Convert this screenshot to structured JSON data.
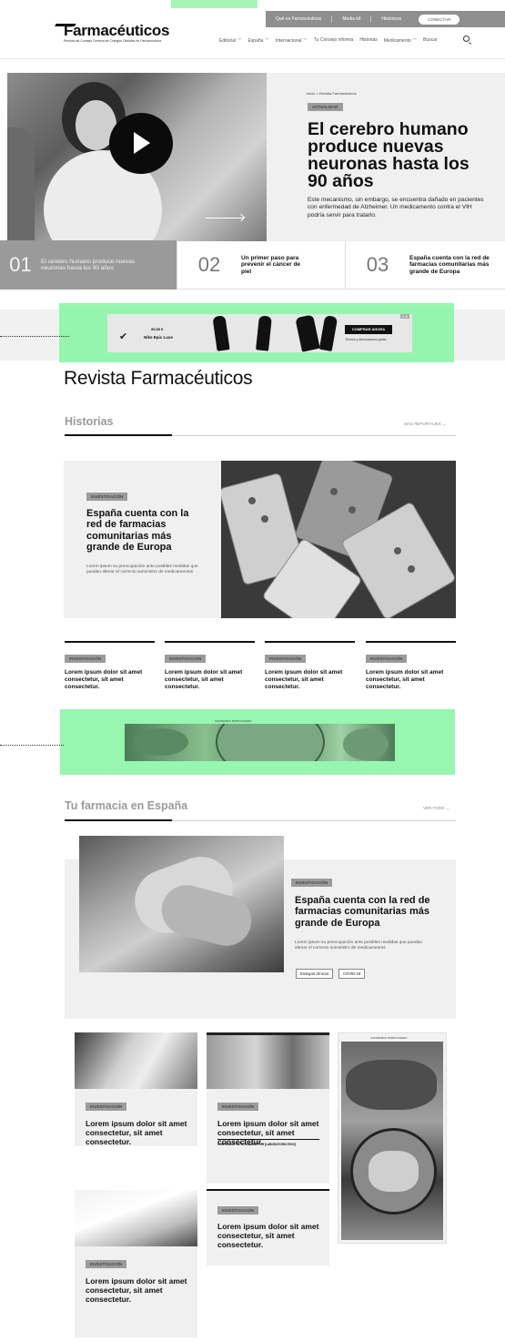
{
  "topbar": {
    "links": [
      "Qué es Farmacéuticos",
      "Media kit",
      "Históricos"
    ],
    "connect": "CONECTAR"
  },
  "brand": {
    "name": "Farmacéuticos",
    "subtitle": "Revista del Consejo General de Colegios Oficiales de Farmacéuticos"
  },
  "nav": {
    "items": [
      "Editorial ﹀",
      "España ﹀",
      "Internacional ﹀",
      "Tu Consejo informa",
      "Historias",
      "Medicamento ﹀",
      "Buscar"
    ]
  },
  "hero": {
    "breadcrumb": "Inicio > Revista Farmacéuticos",
    "tag": "ACTUALIDAD",
    "title": "El cerebro humano produce nuevas neuronas hasta los 90 años",
    "lead": "Este mecanismo, sin embargo, se encuentra dañado en pacientes con enfermedad de Alzheimer. Un medicamento contra el VIH podría servir para tratarlo."
  },
  "strip": [
    {
      "num": "01",
      "text": "El cerebro humano produce nuevas neuronas hasta los 90 años"
    },
    {
      "num": "02",
      "text": "Un primer paso para prevenir el cáncer de piel"
    },
    {
      "num": "03",
      "text": "España cuenta con la red de farmacias comunitarias más grande de Europa"
    }
  ],
  "ad1": {
    "price": "99,99 €",
    "product": "Nike Epic Luxe",
    "cta": "COMPRAR AHORA",
    "sub": "Envíos y devoluciones gratis",
    "badge": "▷✕"
  },
  "revista": {
    "title": "Revista Farmacéuticos"
  },
  "historias": {
    "heading": "Historias",
    "more": "MÁS REPORTAJES →",
    "featured": {
      "tag": "INVESTIGACIÓN",
      "title": "España cuenta con la red de farmacias comunitarias más grande de Europa",
      "desc": "Lorem ipsum su preocupación ante posibles medidas que puedan alterar el correcto suministro de medicamentos"
    },
    "cards": [
      {
        "tag": "INVESTIGACIÓN",
        "title": "Lorem ipsum dolor sit amet consectetur, sit amet consectetur."
      },
      {
        "tag": "INVESTIGACIÓN",
        "title": "Lorem ipsum dolor sit amet consectetur, sit amet consectetur."
      },
      {
        "tag": "INVESTIGACIÓN",
        "title": "Lorem ipsum dolor sit amet consectetur, sit amet consectetur."
      },
      {
        "tag": "INVESTIGACIÓN",
        "title": "Lorem ipsum dolor sit amet consectetur, sit amet consectetur."
      }
    ]
  },
  "ad2": {
    "label": "CONTENIDO PATROCINADO"
  },
  "farmacia": {
    "heading": "Tu farmacia en España",
    "more": "VER TODO →",
    "featured": {
      "tag": "INVESTIGACIÓN",
      "title": "España cuenta con la red de farmacias comunitarias más grande de Europa",
      "desc": "Lorem ipsum su preocupación ante posibles medidas que puedan alterar el correcto suministro de medicamentos",
      "chips": [
        "Ensayos clínicos",
        "COVID-19"
      ]
    },
    "grid": [
      {
        "tag": "INVESTIGACIÓN",
        "title": "Lorem ipsum dolor sit amet consectetur, sit amet consectetur."
      },
      {
        "tag": "INVESTIGACIÓN",
        "title": "Lorem ipsum dolor sit amet consectetur, sit amet consectetur.",
        "sponsor": "CONTENIDO PATROCINADO POR [LABORATORIO ROVI]"
      },
      {
        "tag": "INVESTIGACIÓN",
        "title": "Lorem ipsum dolor sit amet consectetur, sit amet consectetur."
      },
      {
        "tag": "INVESTIGACIÓN",
        "title": "Lorem ipsum dolor sit amet consectetur, sit amet consectetur."
      }
    ],
    "sponsored_label": "CONTENIDO PATROCINADO"
  },
  "colors": {
    "accent_green": "#85f5a2",
    "tag_gray": "#9b9b9b",
    "panel": "#f0f0f0"
  }
}
